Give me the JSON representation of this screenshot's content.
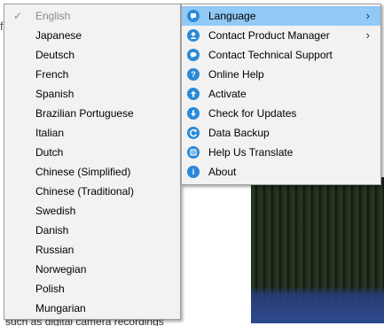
{
  "language_menu": {
    "items": [
      {
        "label": "English",
        "checked": true,
        "disabled": true
      },
      {
        "label": "Japanese"
      },
      {
        "label": "Deutsch"
      },
      {
        "label": "French"
      },
      {
        "label": "Spanish"
      },
      {
        "label": "Brazilian Portuguese"
      },
      {
        "label": "Italian"
      },
      {
        "label": "Dutch"
      },
      {
        "label": "Chinese (Simplified)"
      },
      {
        "label": "Chinese (Traditional)"
      },
      {
        "label": "Swedish"
      },
      {
        "label": "Danish"
      },
      {
        "label": "Russian"
      },
      {
        "label": "Norwegian"
      },
      {
        "label": "Polish"
      },
      {
        "label": "Mungarian"
      }
    ],
    "check_glyph": "✓"
  },
  "help_menu": {
    "items": [
      {
        "label": "Language",
        "icon": "language-icon",
        "submenu": true,
        "highlighted": true
      },
      {
        "label": "Contact Product Manager",
        "icon": "contact-manager-icon",
        "submenu": true
      },
      {
        "label": "Contact Technical Support",
        "icon": "technical-support-icon"
      },
      {
        "label": "Online Help",
        "icon": "help-icon"
      },
      {
        "label": "Activate",
        "icon": "activate-icon"
      },
      {
        "label": "Check for Updates",
        "icon": "update-icon"
      },
      {
        "label": "Data Backup",
        "icon": "backup-icon"
      },
      {
        "label": "Help Us Translate",
        "icon": "translate-icon"
      },
      {
        "label": "About",
        "icon": "info-icon"
      }
    ],
    "arrow_glyph": "›"
  },
  "background": {
    "partial_text": "such as digital camera recordings",
    "partial_letter": "f"
  },
  "colors": {
    "menu_bg": "#f2f2f2",
    "highlight": "#91c9f7",
    "icon_blue": "#2b8ad7",
    "disabled_text": "#8c8c8c"
  }
}
